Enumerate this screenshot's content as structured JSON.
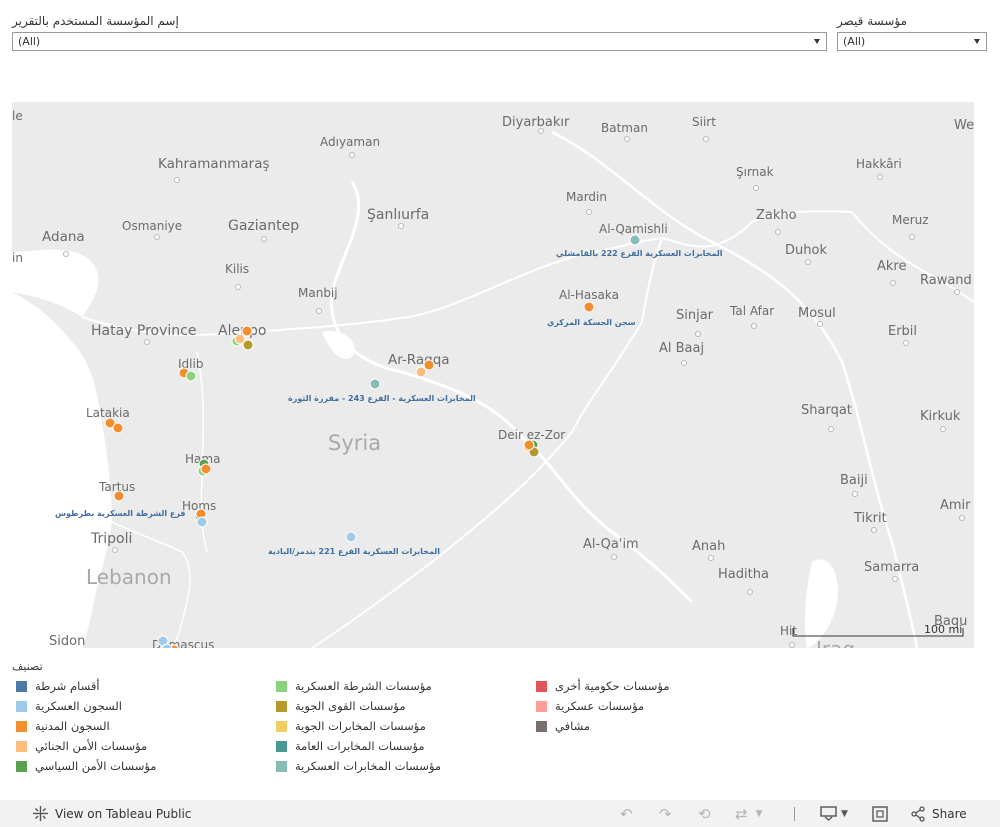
{
  "filters": {
    "report_user_label": "إسم المؤسسة المستخدم بالتقرير",
    "report_user_value": "(All)",
    "caesar_label": "مؤسسة قيصر",
    "caesar_value": "(All)"
  },
  "map": {
    "country_label": "Syria",
    "lebanon_label": "Lebanon",
    "iraq_label": "Iraq",
    "scale_label": "100 mi",
    "places": [
      "Diyarbakır",
      "Batman",
      "Siirt",
      "Kahramanmaraş",
      "Adıyaman",
      "Şırnak",
      "Hakkâri",
      "Mardin",
      "Zakho",
      "Adana",
      "Osmaniye",
      "Gaziantep",
      "Şanlıurfa",
      "Al-Qamishli",
      "Meruz",
      "Duhok",
      "Kilis",
      "Akre",
      "Rawand",
      "Manbij",
      "Al-Hasaka",
      "Hatay Province",
      "Aleppo",
      "Sinjar",
      "Tal Afar",
      "Mosul",
      "Erbil",
      "Idlib",
      "Ar-Raqqa",
      "Al Baaj",
      "Latakia",
      "Sharqat",
      "Kirkuk",
      "Deir ez-Zor",
      "Hama",
      "Baiji",
      "Tartus",
      "Homs",
      "Tikrit",
      "Amir",
      "Tripoli",
      "Al-Qa'im",
      "Anah",
      "Haditha",
      "Samarra",
      "Sidon",
      "Damascus",
      "Hit",
      "Baqu",
      "le",
      "We",
      "in"
    ],
    "annotations": [
      "المخابرات العسكرية الفرع 222 بالقامشلي",
      "سجن الحسكة المركزي",
      "المخابرات العسكرية - الفرع 243 - مفرزة الثورة",
      "فرع الشرطة العسكرية بطرطوس",
      "المخابرات العسكرية الفرع 221 بتدمر/البادية"
    ]
  },
  "legend": {
    "title": "تصنيف",
    "items": [
      {
        "label": "أقسام شرطة",
        "color": "#4e79a7"
      },
      {
        "label": "السجون العسكرية",
        "color": "#a0cbe8"
      },
      {
        "label": "السجون المدنية",
        "color": "#f28e2b"
      },
      {
        "label": "مؤسسات الأمن الجنائي",
        "color": "#ffbe7d"
      },
      {
        "label": "مؤسسات الأمن السياسي",
        "color": "#59a14f"
      },
      {
        "label": "مؤسسات الشرطة العسكرية",
        "color": "#8cd17d"
      },
      {
        "label": "مؤسسات القوى الجوية",
        "color": "#b6992d"
      },
      {
        "label": "مؤسسات المخابرات الجوية",
        "color": "#f1ce63"
      },
      {
        "label": "مؤسسات المخابرات العامة",
        "color": "#499894"
      },
      {
        "label": "مؤسسات المخابرات العسكرية",
        "color": "#86bcb6"
      },
      {
        "label": "مؤسسات حكومية أخرى",
        "color": "#e15759"
      },
      {
        "label": "مؤسسات عسكرية",
        "color": "#ff9d9a"
      },
      {
        "label": "مشافي",
        "color": "#79706e"
      }
    ]
  },
  "toolbar": {
    "view_on_public": "View on Tableau Public",
    "share": "Share"
  }
}
